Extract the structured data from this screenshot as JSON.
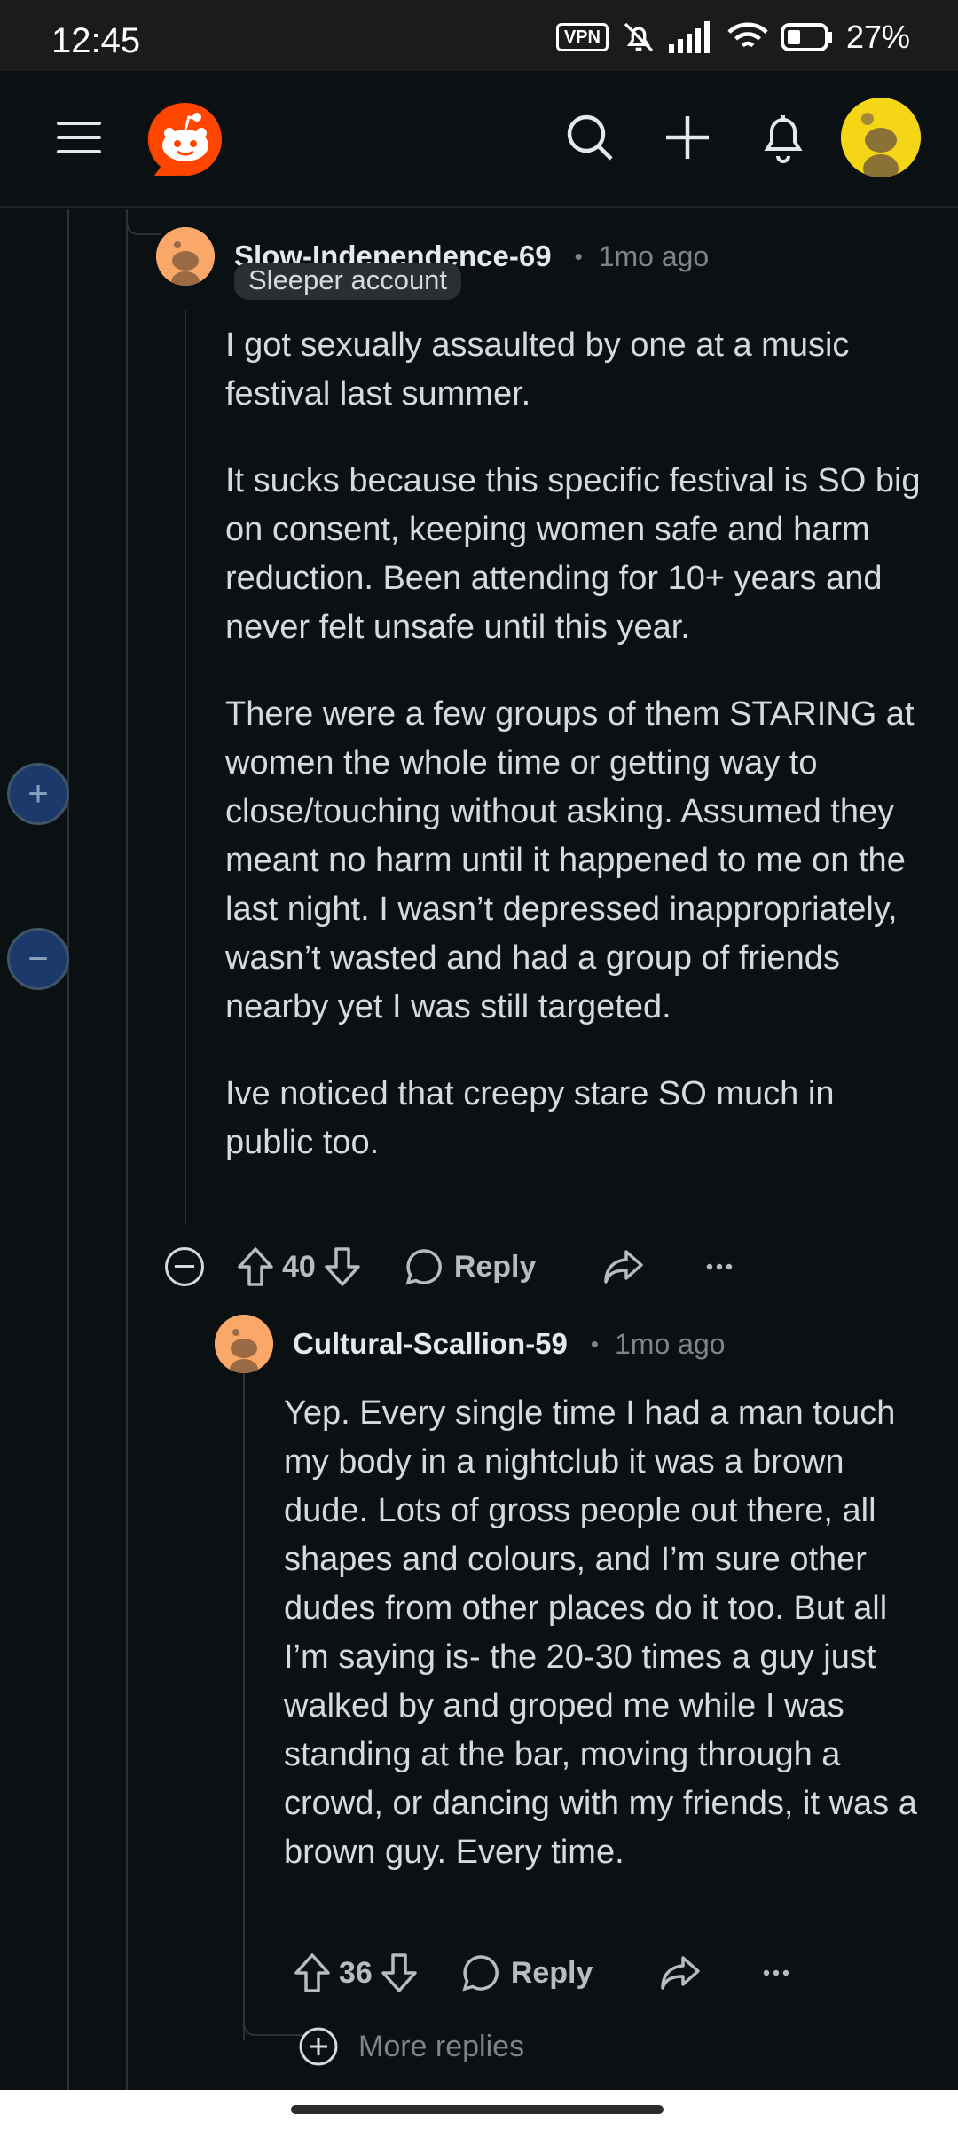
{
  "status_bar": {
    "time": "12:45",
    "vpn_label": "VPN",
    "battery": "27%"
  },
  "app_header": {
    "icons": [
      "menu-icon",
      "reddit-logo",
      "search-icon",
      "add-icon",
      "bell-icon",
      "avatar"
    ]
  },
  "comment1": {
    "username": "Slow-Independence-69",
    "timestamp": "1mo ago",
    "flair": "Sleeper account",
    "paragraphs": [
      "I got sexually assaulted by one at a music festival last summer.",
      "It sucks because this specific festival is SO big on consent, keeping women safe and harm reduction. Been attending for 10+ years and never felt unsafe until this year.",
      "There were a few groups of them STARING at women the whole time or getting way to close/touching without asking. Assumed they meant no harm until it happened to me on the last night. I wasn’t depressed inappropriately, wasn’t wasted and had a group of friends nearby yet I was still targeted.",
      "Ive noticed that creepy stare SO much in public too."
    ],
    "votes": "40",
    "reply_label": "Reply"
  },
  "comment2": {
    "username": "Cultural-Scallion-59",
    "timestamp": "1mo ago",
    "paragraphs": [
      "Yep. Every single time I had a man touch my body in a nightclub it was a brown dude. Lots of gross people out there, all shapes and colours, and I’m sure other dudes from other places do it too. But all I’m saying is- the 20-30 times a guy just walked by and groped me while I was standing at the bar, moving through a crowd, or dancing with my friends, it was a brown guy. Every time."
    ],
    "votes": "36",
    "reply_label": "Reply"
  },
  "more_replies_label": "More replies",
  "side_controls": {
    "expand_symbol": "+",
    "collapse_symbol": "−"
  },
  "colors": {
    "background": "#0b1012",
    "text": "#d7dadc",
    "muted": "#818384",
    "reddit_orange": "#ff4500",
    "avatar_yellow": "#f5d616"
  }
}
